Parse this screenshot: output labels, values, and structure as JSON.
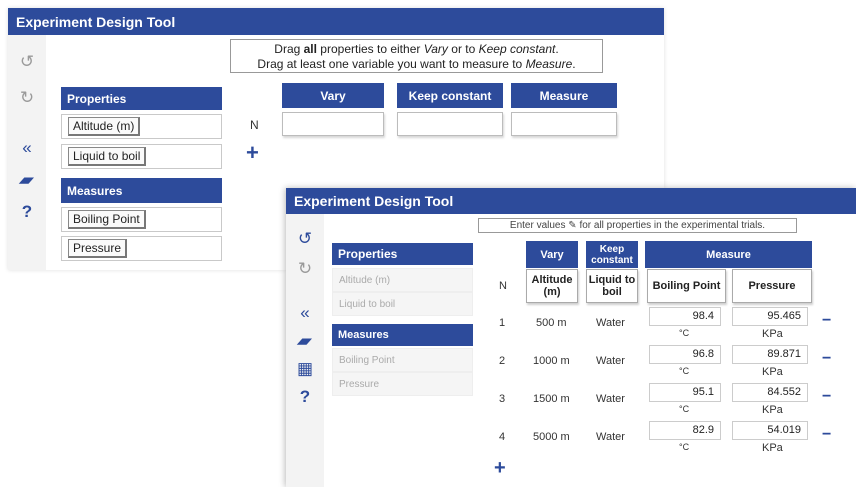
{
  "window1": {
    "title": "Experiment Design Tool",
    "instruction_line1_pre": "Drag ",
    "instruction_line1_bold": "all",
    "instruction_line1_mid": " properties to either ",
    "instruction_line1_vary": "Vary",
    "instruction_line1_or": " or to ",
    "instruction_line1_keep": "Keep constant",
    "instruction_line1_end": ".",
    "instruction_line2_pre": "Drag at least one variable you want to measure to ",
    "instruction_line2_measure": "Measure",
    "instruction_line2_end": ".",
    "properties_label": "Properties",
    "properties": [
      "Altitude (m)",
      "Liquid to boil"
    ],
    "measures_label": "Measures",
    "measures": [
      "Boiling Point",
      "Pressure"
    ],
    "n_label": "N",
    "columns": [
      "Vary",
      "Keep constant",
      "Measure"
    ]
  },
  "window2": {
    "title": "Experiment Design Tool",
    "instruction_pre": "Enter values",
    "instruction_post": " for all properties in the experimental trials.",
    "properties_label": "Properties",
    "properties": [
      "Altitude (m)",
      "Liquid to boil"
    ],
    "measures_label": "Measures",
    "measures": [
      "Boiling Point",
      "Pressure"
    ],
    "n_label": "N",
    "vary_label": "Vary",
    "keep_label": "Keep constant",
    "measure_label": "Measure",
    "sub_altitude": "Altitude (m)",
    "sub_liquid": "Liquid to boil",
    "sub_boiling": "Boiling Point",
    "sub_pressure": "Pressure",
    "rows": [
      {
        "n": "1",
        "alt": "500 m",
        "liq": "Water",
        "bp": "98.4",
        "bp_unit": "°C",
        "pr": "95.465",
        "pr_unit": "KPa"
      },
      {
        "n": "2",
        "alt": "1000 m",
        "liq": "Water",
        "bp": "96.8",
        "bp_unit": "°C",
        "pr": "89.871",
        "pr_unit": "KPa"
      },
      {
        "n": "3",
        "alt": "1500 m",
        "liq": "Water",
        "bp": "95.1",
        "bp_unit": "°C",
        "pr": "84.552",
        "pr_unit": "KPa"
      },
      {
        "n": "4",
        "alt": "5000 m",
        "liq": "Water",
        "bp": "82.9",
        "bp_unit": "°C",
        "pr": "54.019",
        "pr_unit": "KPa"
      }
    ]
  },
  "icons": {
    "undo": "↺",
    "redo": "↻",
    "collapse": "«",
    "eraser": "▰",
    "table": "▦",
    "help": "?",
    "plus": "+",
    "minus": "−",
    "edit": "✎"
  },
  "colors": {
    "accent": "#2d4b9b"
  }
}
